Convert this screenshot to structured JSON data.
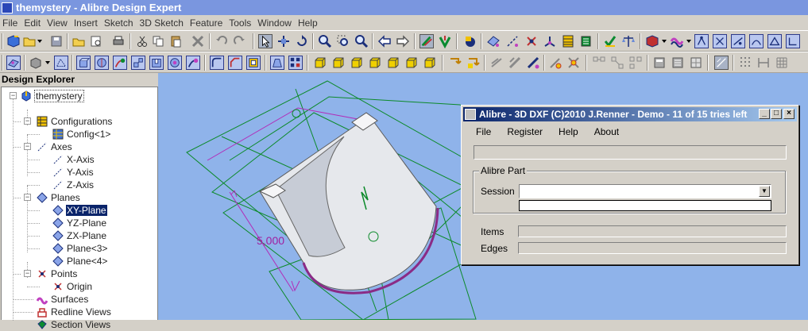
{
  "window": {
    "title": "themystery - Alibre Design Expert"
  },
  "menu": [
    "File",
    "Edit",
    "View",
    "Insert",
    "Sketch",
    "3D Sketch",
    "Feature",
    "Tools",
    "Window",
    "Help"
  ],
  "explorer": {
    "title": "Design Explorer",
    "tree": [
      {
        "label": "themystery",
        "icon": "part-icon"
      },
      {
        "label": "Configurations",
        "icon": "configurations-icon"
      },
      {
        "label": "Config<1>",
        "icon": "config-icon"
      },
      {
        "label": "Axes",
        "icon": "axes-icon"
      },
      {
        "label": "X-Axis",
        "icon": "axis-icon"
      },
      {
        "label": "Y-Axis",
        "icon": "axis-icon"
      },
      {
        "label": "Z-Axis",
        "icon": "axis-icon"
      },
      {
        "label": "Planes",
        "icon": "planes-icon"
      },
      {
        "label": "XY-Plane",
        "icon": "plane-icon",
        "selected": true
      },
      {
        "label": "YZ-Plane",
        "icon": "plane-icon"
      },
      {
        "label": "ZX-Plane",
        "icon": "plane-icon"
      },
      {
        "label": "Plane<3>",
        "icon": "plane-icon"
      },
      {
        "label": "Plane<4>",
        "icon": "plane-icon"
      },
      {
        "label": "Points",
        "icon": "points-icon"
      },
      {
        "label": "Origin",
        "icon": "point-icon"
      },
      {
        "label": "Surfaces",
        "icon": "surfaces-icon"
      },
      {
        "label": "Redline Views",
        "icon": "redline-icon"
      },
      {
        "label": "Section Views",
        "icon": "section-views-icon"
      }
    ]
  },
  "viewport": {
    "dimension_label": "5,000"
  },
  "dialog": {
    "title": "Alibre - 3D DXF (C)2010 J.Renner - Demo - 11 of 15 tries left",
    "menu": [
      "File",
      "Register",
      "Help",
      "About"
    ],
    "group_label": "Alibre Part",
    "session_label": "Session",
    "session_value": "",
    "items_label": "Items",
    "edges_label": "Edges"
  },
  "colors": {
    "titlebar": "#7a96df",
    "dialog_title_start": "#0a246a",
    "dialog_title_end": "#a6caf0",
    "viewport_bg": "#8fb3ea",
    "selection": "#0a246a",
    "part_face": "#e6e8ec",
    "part_edge": "#8a2b86",
    "plane_lines": "#0c8a2a"
  }
}
